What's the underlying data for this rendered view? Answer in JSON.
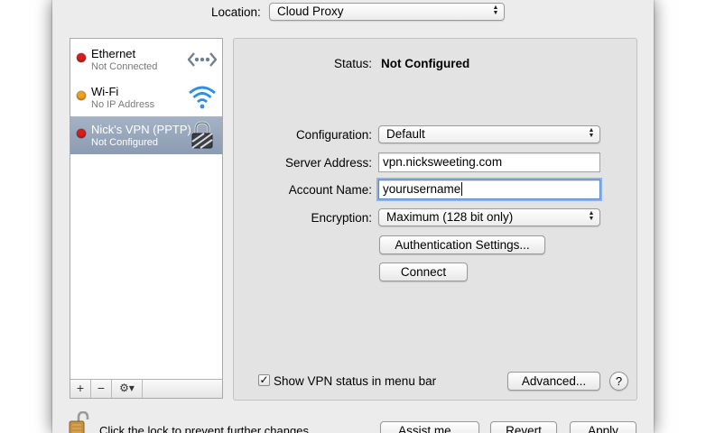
{
  "location": {
    "label": "Location:",
    "value": "Cloud Proxy"
  },
  "services": [
    {
      "name": "Ethernet",
      "status": "Not Connected",
      "dot_color": "#d81d1d",
      "icon": "ethernet-icon",
      "selected": false
    },
    {
      "name": "Wi-Fi",
      "status": "No IP Address",
      "dot_color": "#f0a11c",
      "icon": "wifi-icon",
      "selected": false
    },
    {
      "name": "Nick's VPN (PPTP)",
      "status": "Not Configured",
      "dot_color": "#d81d1d",
      "icon": "vpn-lock-icon",
      "selected": true
    }
  ],
  "sidebar_toolbar": {
    "add": "+",
    "remove": "−",
    "action": "⚙▾"
  },
  "status": {
    "label": "Status:",
    "value": "Not Configured"
  },
  "form": {
    "configuration": {
      "label": "Configuration:",
      "value": "Default"
    },
    "server_address": {
      "label": "Server Address:",
      "value": "vpn.nicksweeting.com"
    },
    "account_name": {
      "label": "Account Name:",
      "value": "yourusername"
    },
    "encryption": {
      "label": "Encryption:",
      "value": "Maximum (128 bit only)"
    }
  },
  "buttons": {
    "auth_settings": "Authentication Settings...",
    "connect": "Connect",
    "advanced": "Advanced...",
    "help": "?",
    "assist": "Assist me...",
    "revert": "Revert",
    "apply": "Apply"
  },
  "show_vpn_status": {
    "label": "Show VPN status in menu bar",
    "checked": true,
    "mark": "✓"
  },
  "lock_text": "Click the lock to prevent further changes."
}
